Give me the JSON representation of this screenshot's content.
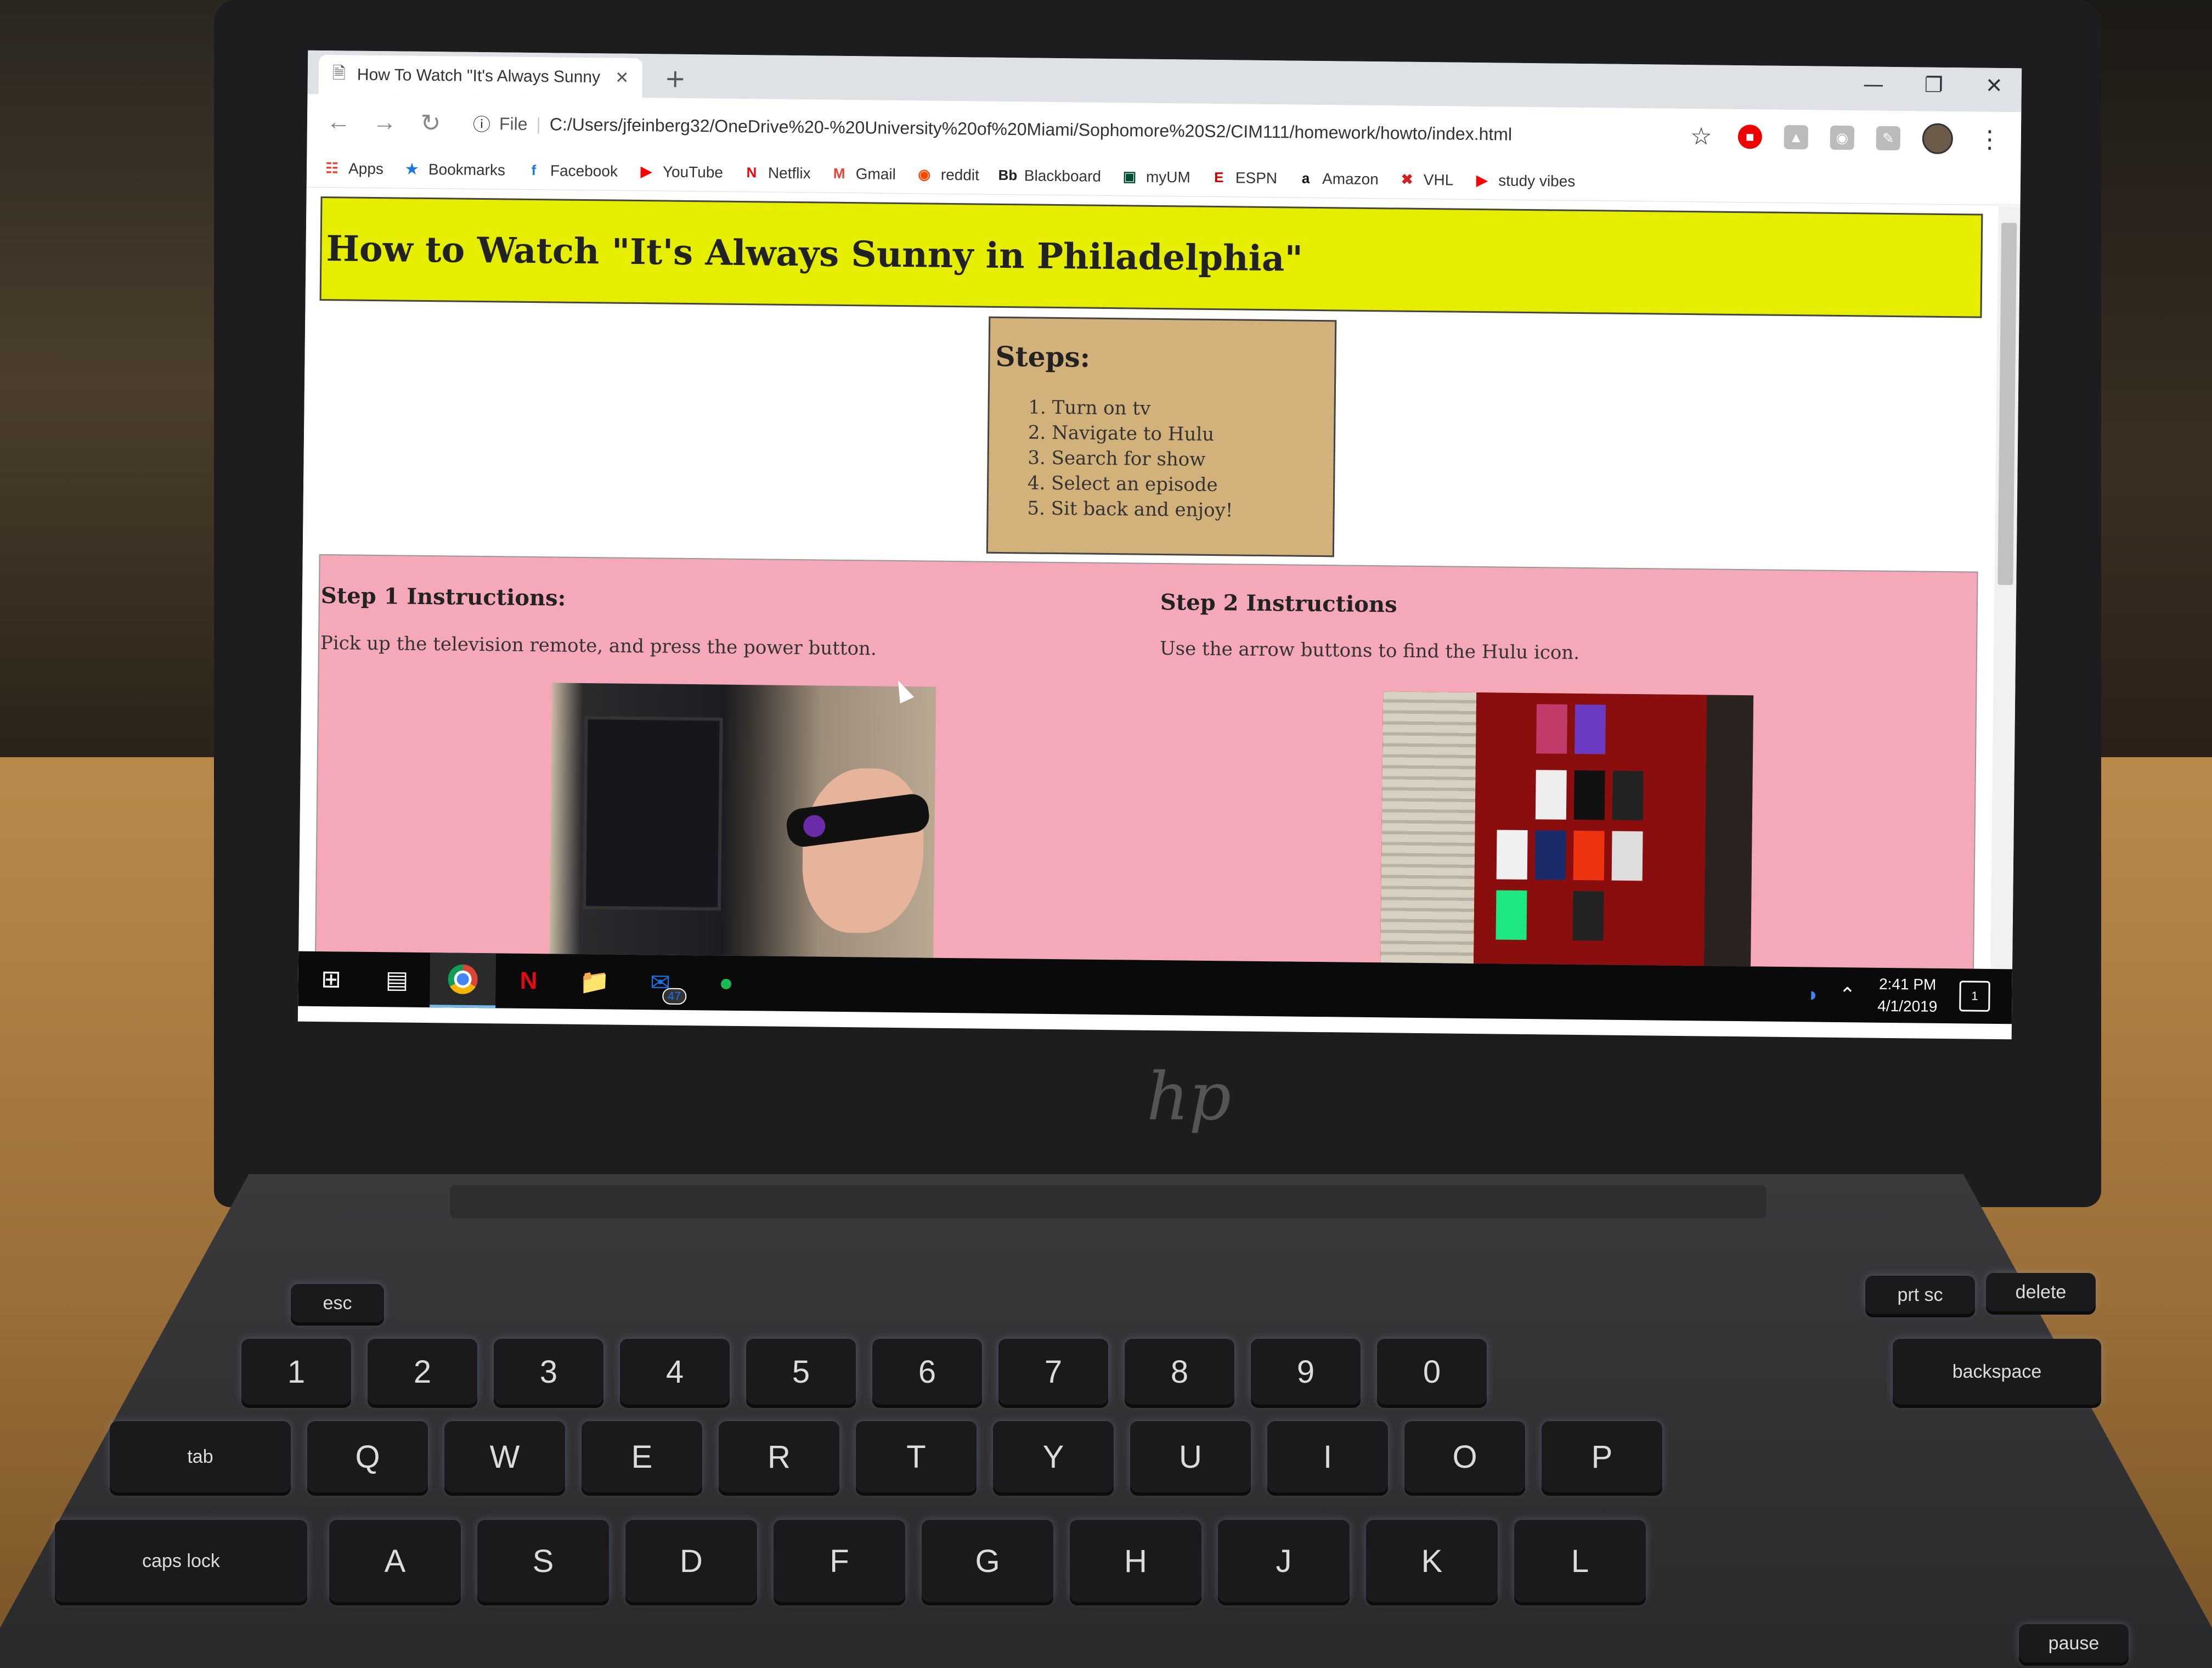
{
  "browser": {
    "tab_title": "How To Watch \"It's Always Sunny",
    "url_scheme": "File",
    "url": "C:/Users/jfeinberg32/OneDrive%20-%20University%20of%20Miami/Sophomore%20S2/CIM111/homework/howto/index.html",
    "bookmarks": [
      {
        "label": "Apps",
        "icon": "apps-grid-icon",
        "color": "#ea4335"
      },
      {
        "label": "Bookmarks",
        "icon": "star-icon",
        "color": "#1a73e8"
      },
      {
        "label": "Facebook",
        "icon": "facebook-icon",
        "color": "#1877f2"
      },
      {
        "label": "YouTube",
        "icon": "youtube-icon",
        "color": "#ff0000"
      },
      {
        "label": "Netflix",
        "icon": "netflix-icon",
        "color": "#e50914"
      },
      {
        "label": "Gmail",
        "icon": "gmail-icon",
        "color": "#ea4335"
      },
      {
        "label": "reddit",
        "icon": "reddit-icon",
        "color": "#ff4500"
      },
      {
        "label": "Blackboard",
        "icon": "blackboard-icon",
        "color": "#222222"
      },
      {
        "label": "myUM",
        "icon": "myum-icon",
        "color": "#005030"
      },
      {
        "label": "ESPN",
        "icon": "espn-icon",
        "color": "#d00000"
      },
      {
        "label": "Amazon",
        "icon": "amazon-icon",
        "color": "#111111"
      },
      {
        "label": "VHL",
        "icon": "vhl-icon",
        "color": "#d02020"
      },
      {
        "label": "study vibes",
        "icon": "youtube-icon",
        "color": "#ff0000"
      }
    ]
  },
  "page": {
    "title": "How to Watch \"It's Always Sunny in Philadelphia\"",
    "banner_color": "#e6ee00",
    "steps_heading": "Steps:",
    "steps": [
      "Turn on tv",
      "Navigate to Hulu",
      "Search for show",
      "Select an episode",
      "Sit back and enjoy!"
    ],
    "step1": {
      "heading": "Step 1 Instructions:",
      "text": "Pick up the television remote, and press the power button."
    },
    "step2": {
      "heading": "Step 2 Instructions",
      "text": "Use the arrow buttons to find the Hulu icon."
    }
  },
  "taskbar": {
    "mail_badge": "47",
    "time": "2:41 PM",
    "date": "4/1/2019",
    "notification_count": "1"
  },
  "keyboard": {
    "row_numbers": [
      "esc",
      "!\n1",
      "@\n2",
      "#\n3",
      "$\n4",
      "%\n5",
      "^\n6",
      "&\n7",
      "*\n8",
      "(\n9",
      ")\n0"
    ],
    "row_qwerty": [
      "tab",
      "Q",
      "W",
      "E",
      "R",
      "T",
      "Y",
      "U",
      "I",
      "O",
      "P"
    ],
    "row_home": [
      "caps lock",
      "A",
      "S",
      "D",
      "F",
      "G",
      "H",
      "J",
      "K",
      "L"
    ],
    "labels": {
      "esc": "esc",
      "tab": "tab",
      "caps": "caps lock",
      "backspace": "backspace",
      "delete": "delete",
      "prtsc": "prt sc",
      "pause": "pause"
    }
  }
}
